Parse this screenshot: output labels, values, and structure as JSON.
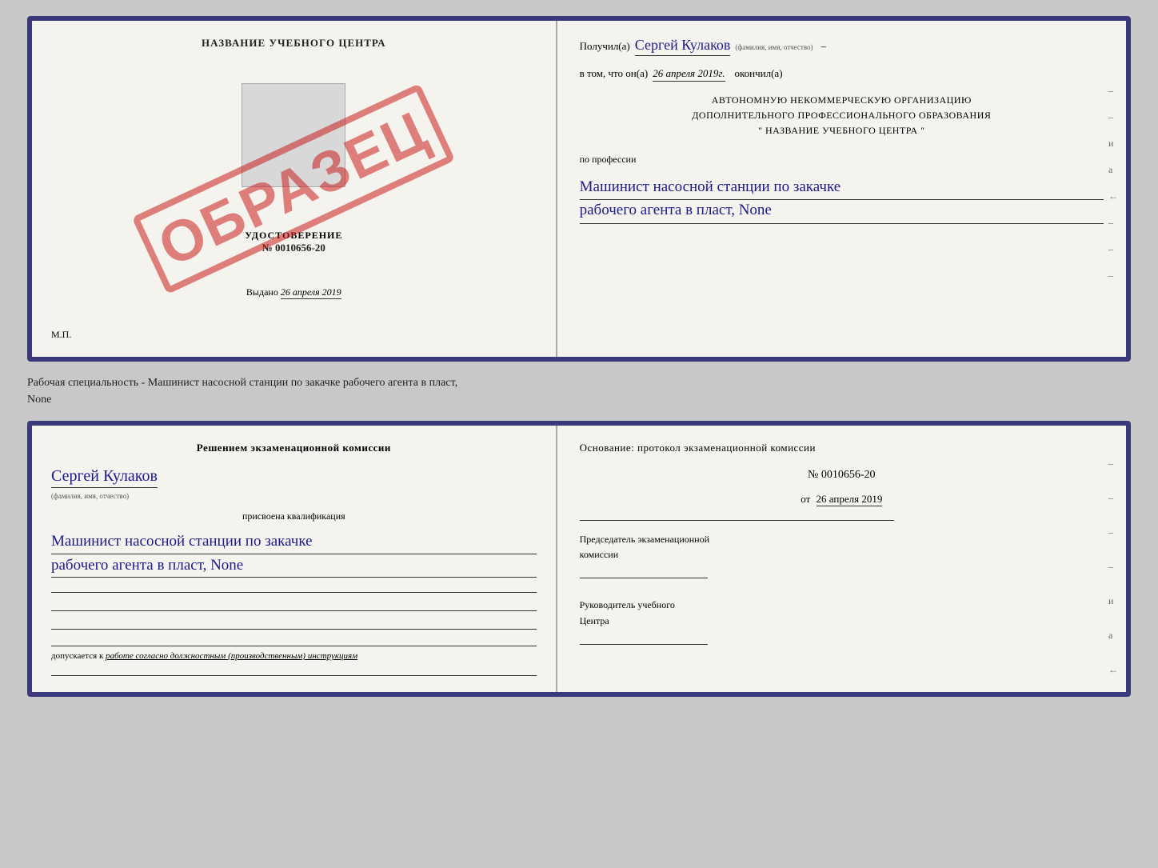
{
  "page": {
    "background": "#c8c8c8"
  },
  "topDoc": {
    "left": {
      "title": "НАЗВАНИЕ УЧЕБНОГО ЦЕНТРА",
      "udostoverenie_label": "УДОСТОВЕРЕНИЕ",
      "number": "№ 0010656-20",
      "vydano_prefix": "Выдано",
      "vydano_date": "26 апреля 2019",
      "mp": "М.П.",
      "obrazets": "ОБРАЗЕЦ"
    },
    "right": {
      "poluchil_label": "Получил(а)",
      "fio": "Сергей Кулаков",
      "fio_hint": "(фамилия, имя, отчество)",
      "dash1": "–",
      "vtom_label": "в том, что он(а)",
      "date": "26 апреля 2019г.",
      "okonchil": "окончил(а)",
      "org_line1": "АВТОНОМНУЮ НЕКОММЕРЧЕСКУЮ ОРГАНИЗАЦИЮ",
      "org_line2": "ДОПОЛНИТЕЛЬНОГО ПРОФЕССИОНАЛЬНОГО ОБРАЗОВАНИЯ",
      "org_line3": "\"  НАЗВАНИЕ УЧЕБНОГО ЦЕНТРА  \"",
      "po_professii": "по профессии",
      "profession1": "Машинист насосной станции по закачке",
      "profession2": "рабочего агента в пласт, None",
      "dashes": [
        "–",
        "–",
        "–",
        "–",
        "–",
        "–"
      ],
      "i_label": "и",
      "a_label": "а",
      "arrow_label": "←"
    }
  },
  "middleText": {
    "line1": "Рабочая специальность - Машинист насосной станции по закачке рабочего агента в пласт,",
    "line2": "None"
  },
  "bottomDoc": {
    "left": {
      "resheniem": "Решением экзаменационной комиссии",
      "fio": "Сергей Кулаков",
      "fio_hint": "(фамилия, имя, отчество)",
      "prisvoena": "присвоена квалификация",
      "kvali1": "Машинист насосной станции по закачке",
      "kvali2": "рабочего агента в пласт, None",
      "dopusk_prefix": "допускается к",
      "dopusk_text": "работе согласно должностным (производственным) инструкциям"
    },
    "right": {
      "osnovanie": "Основание: протокол экзаменационной комиссии",
      "number": "№ 0010656-20",
      "ot_prefix": "от",
      "ot_date": "26 апреля 2019",
      "predsedatel1": "Председатель экзаменационной",
      "predsedatel2": "комиссии",
      "rukovoditel1": "Руководитель учебного",
      "rukovoditel2": "Центра",
      "dashes": [
        "–",
        "–",
        "–",
        "–",
        "–",
        "–",
        "–",
        "–"
      ],
      "i_label": "и",
      "a_label": "а",
      "arrow_label": "←"
    }
  }
}
